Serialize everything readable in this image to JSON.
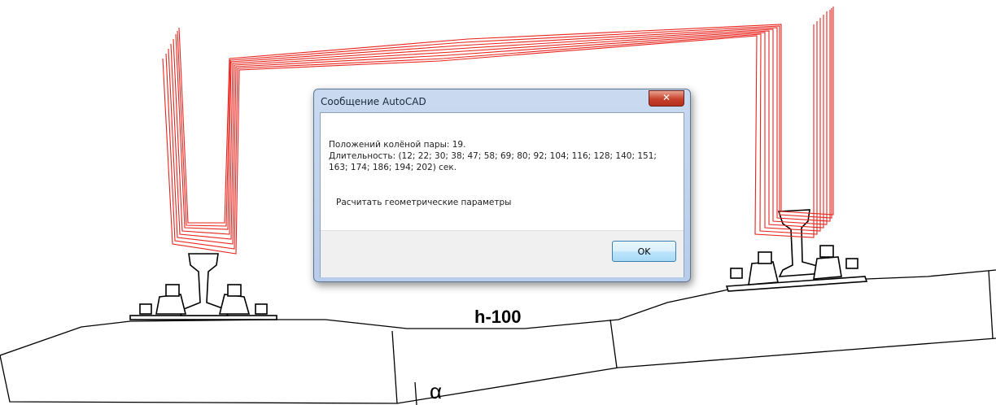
{
  "drawing": {
    "dimension_label": "h-100",
    "angle_label": "α",
    "wheelset_color": "#e8231c"
  },
  "dialog": {
    "title": "Сообщение AutoCAD",
    "close_glyph": "✕",
    "message_line1": "Положений колёной пары:  19.",
    "message_line2": "Длительность: (12; 22; 30; 38; 47; 58; 69; 80; 92; 104; 116; 128; 140; 151;",
    "message_line3": "163; 174; 186; 194; 202) сек.",
    "calc_text": "Расчитать геометрические параметры",
    "ok_label": "OK"
  }
}
